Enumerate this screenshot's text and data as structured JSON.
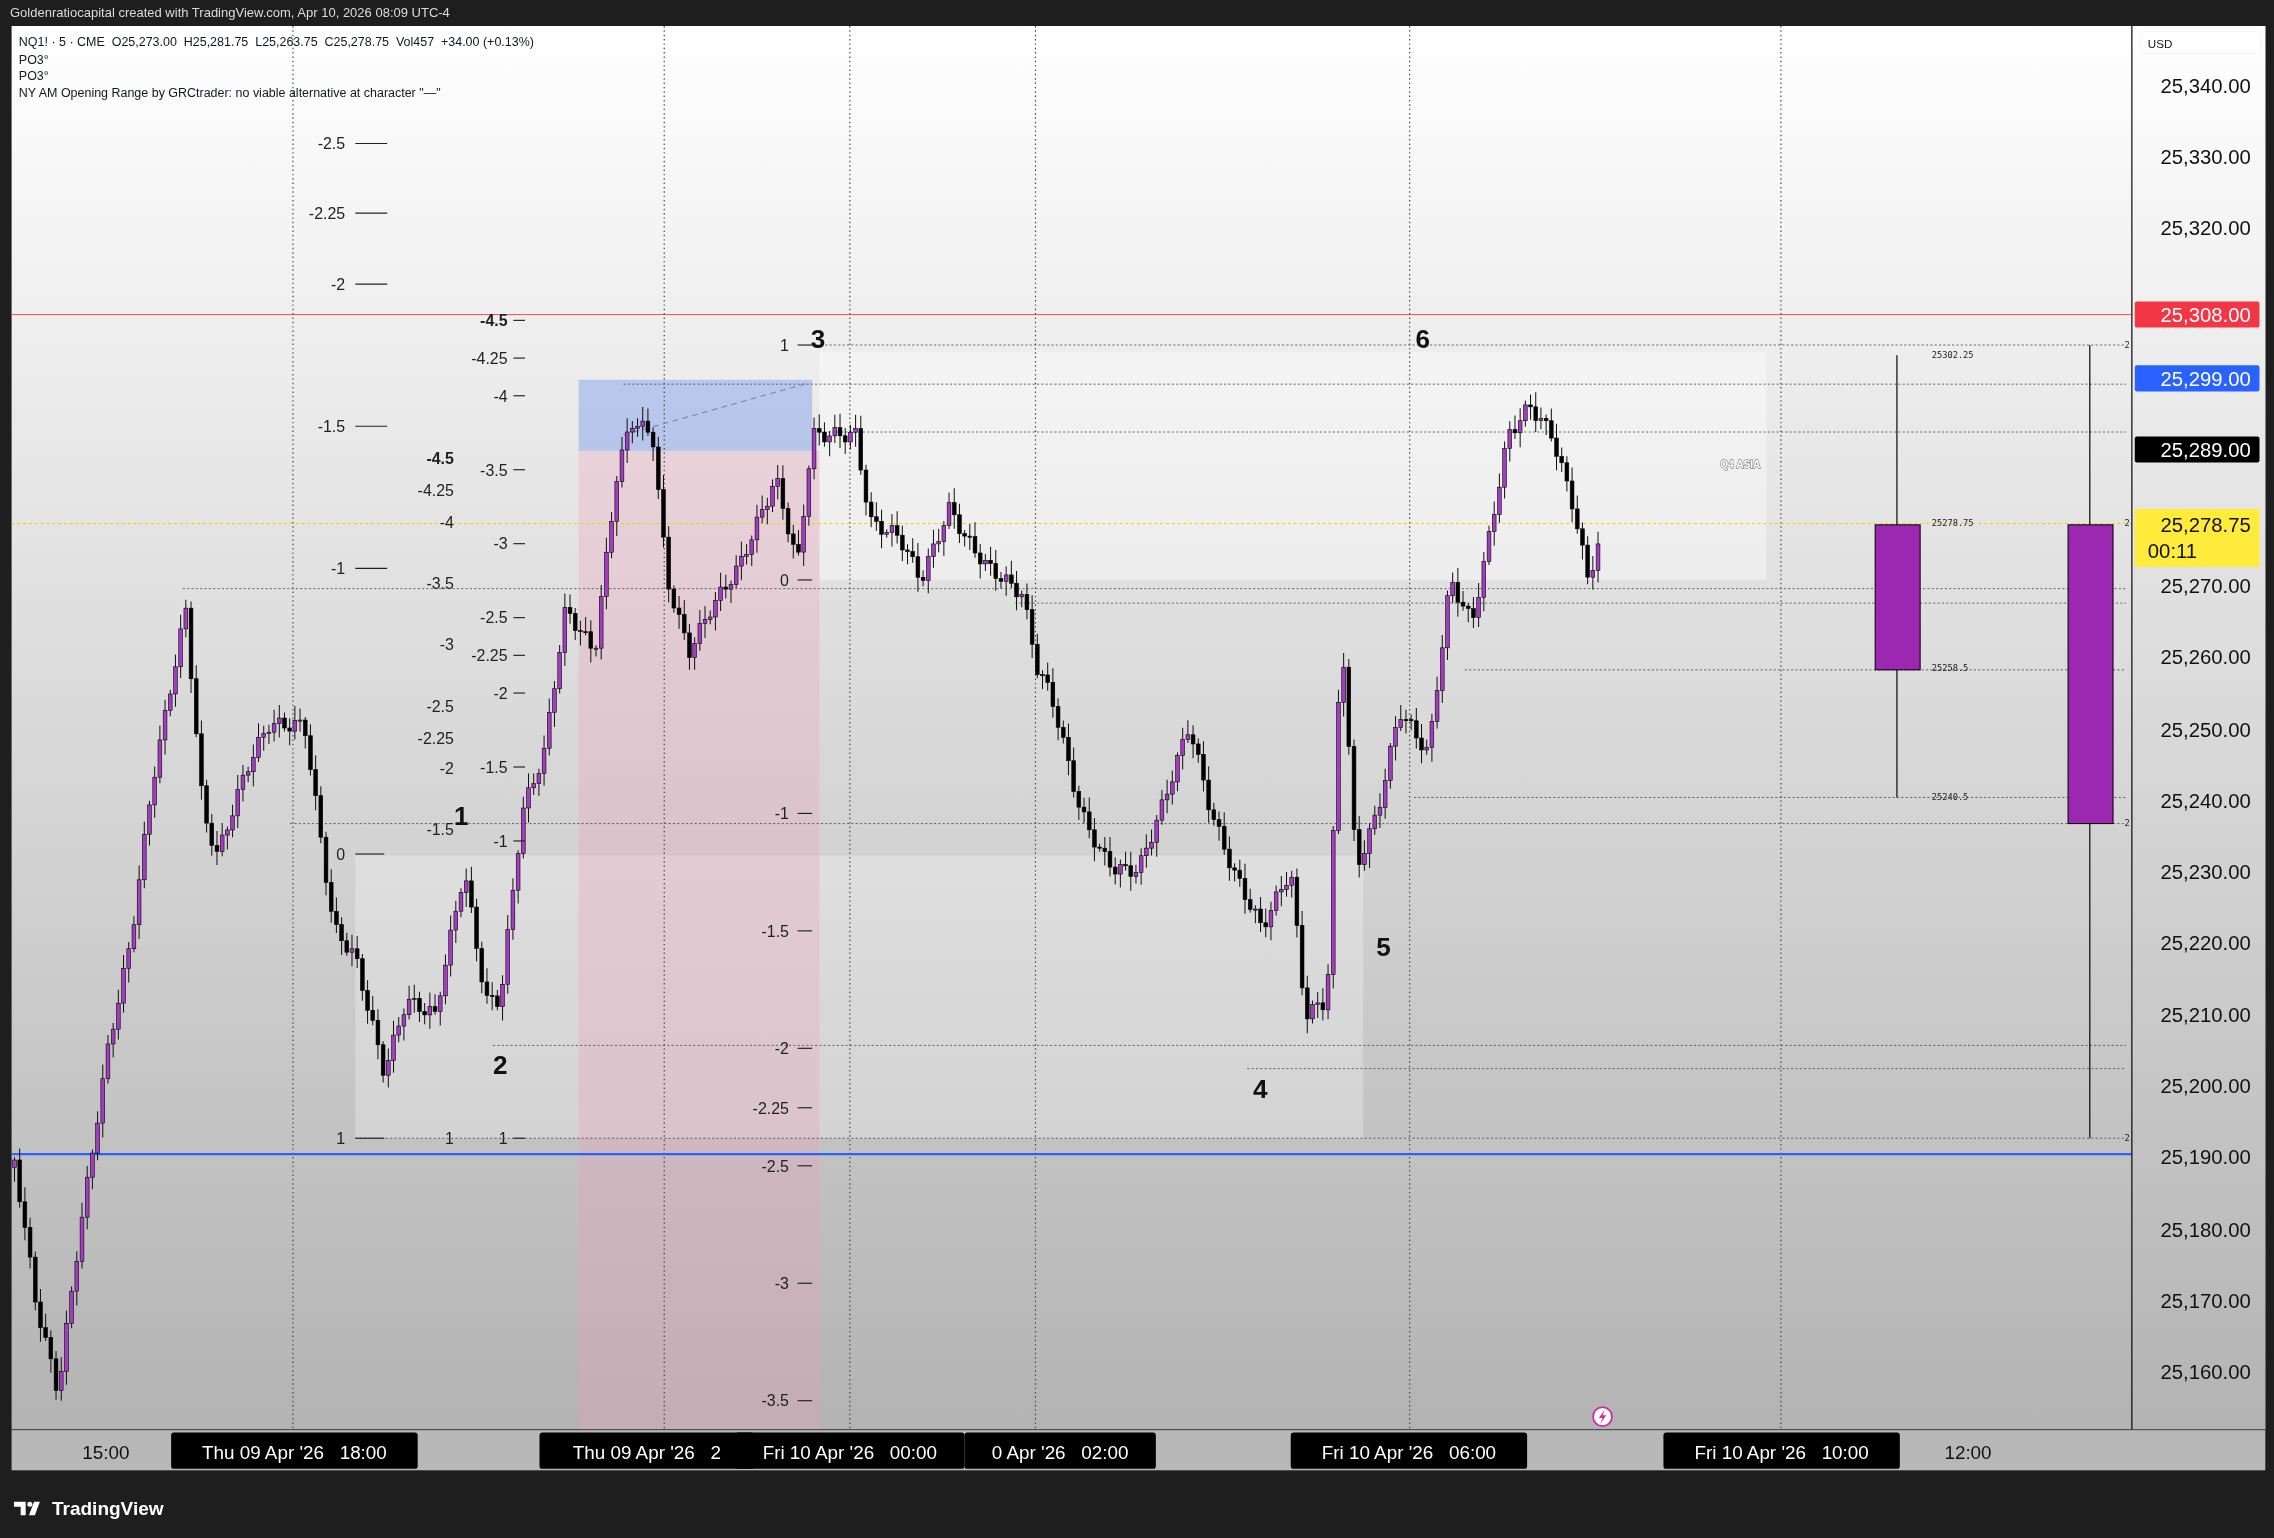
{
  "header": {
    "attribution": "Goldenratiocapital created with TradingView.com, Apr 10, 2026 08:09 UTC-4"
  },
  "legend": {
    "symbol_line": "NQ1! · 5 · CME  O25,273.00  H25,281.75  L25,263.75  C25,278.75  Vol457  +34.00 (+0.13%)",
    "indicators": [
      "PO3°",
      "PO3°",
      "NY AM Opening Range by GRCtrader: no viable alternative at character \"—\""
    ]
  },
  "fib_sets": [
    {
      "kind": "ruled",
      "levels": [
        {
          "label": "-2.5",
          "bold": false
        },
        {
          "label": "-2.25",
          "bold": false
        },
        {
          "label": "-2",
          "bold": false
        },
        {
          "label": "-1.5",
          "bold": false
        },
        {
          "label": "-1",
          "bold": false
        }
      ]
    },
    {
      "kind": "ruled",
      "levels": [
        {
          "label": "0",
          "bold": false
        },
        {
          "label": "1",
          "bold": false
        }
      ]
    },
    {
      "kind": "plain",
      "levels": [
        {
          "label": "-4.5",
          "bold": true
        },
        {
          "label": "-4.25",
          "bold": false
        },
        {
          "label": "-4",
          "bold": false
        },
        {
          "label": "-3.5",
          "bold": false
        },
        {
          "label": "-3",
          "bold": false
        },
        {
          "label": "-2.5",
          "bold": false
        },
        {
          "label": "-2.25",
          "bold": false
        },
        {
          "label": "-2",
          "bold": false
        },
        {
          "label": "-1.5",
          "bold": false
        },
        {
          "label": "1",
          "bold": false
        }
      ]
    },
    {
      "kind": "ruled",
      "levels": [
        {
          "label": "-4.5",
          "bold": true
        },
        {
          "label": "-4.25",
          "bold": false
        },
        {
          "label": "-4",
          "bold": false
        },
        {
          "label": "-3.5",
          "bold": false
        },
        {
          "label": "-3",
          "bold": false
        },
        {
          "label": "-2.5",
          "bold": false
        },
        {
          "label": "-2.25",
          "bold": false
        },
        {
          "label": "-2",
          "bold": false
        },
        {
          "label": "-1.5",
          "bold": false
        },
        {
          "label": "-1",
          "bold": false
        },
        {
          "label": "1",
          "bold": false
        }
      ]
    },
    {
      "kind": "ruled",
      "levels": [
        {
          "label": "1",
          "bold": false
        },
        {
          "label": "0",
          "bold": false
        },
        {
          "label": "-1",
          "bold": false
        },
        {
          "label": "-1.5",
          "bold": false
        },
        {
          "label": "-2",
          "bold": false
        },
        {
          "label": "-2.25",
          "bold": false
        },
        {
          "label": "-2.5",
          "bold": false
        },
        {
          "label": "-3",
          "bold": false
        },
        {
          "label": "-3.5",
          "bold": false
        }
      ]
    }
  ],
  "waves": [
    "1",
    "2",
    "3",
    "4",
    "5",
    "6"
  ],
  "session_label": "Q4 ASIA",
  "range_labels": [
    "25302.25",
    "25278.75",
    "25258.5",
    "25240.5"
  ],
  "edge_marks": [
    "2",
    "2",
    "2",
    "2"
  ],
  "price_axis": {
    "currency": "USD",
    "ticks": [
      "25,340.00",
      "25,330.00",
      "25,320.00",
      "25,270.00",
      "25,260.00",
      "25,250.00",
      "25,240.00",
      "25,230.00",
      "25,220.00",
      "25,210.00",
      "25,200.00",
      "25,190.00",
      "25,180.00",
      "25,170.00",
      "25,160.00"
    ],
    "badges": [
      {
        "text": "25,308.00",
        "color": "#f23645"
      },
      {
        "text": "25,299.00",
        "color": "#2962ff"
      },
      {
        "text": "25,289.00",
        "color": "#000000"
      }
    ],
    "last": {
      "price": "25,278.75",
      "countdown": "00:11",
      "color": "#ffeb3b"
    }
  },
  "time_axis": [
    {
      "kind": "plain",
      "text": "15:00"
    },
    {
      "kind": "badge",
      "text": "Thu 09 Apr '26   18:00"
    },
    {
      "kind": "badge",
      "text": "Thu 09 Apr '26   2"
    },
    {
      "kind": "badge",
      "text": "Fri 10 Apr '26   00:00"
    },
    {
      "kind": "badge",
      "text": "0 Apr '26   02:00"
    },
    {
      "kind": "badge",
      "text": "Fri 10 Apr '26   06:00"
    },
    {
      "kind": "badge",
      "text": "Fri 10 Apr '26   10:00"
    },
    {
      "kind": "plain",
      "text": "12:00"
    }
  ],
  "footer": {
    "brand": "TradingView"
  }
}
